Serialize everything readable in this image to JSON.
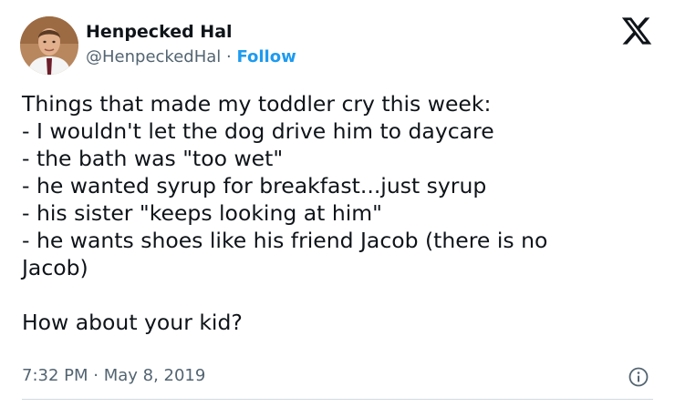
{
  "author": {
    "display_name": "Henpecked Hal",
    "handle": "@HenpeckedHal",
    "separator": " · ",
    "follow_label": "Follow"
  },
  "icons": {
    "brand": "x-logo-icon",
    "info": "info-icon",
    "avatar": "avatar-photo"
  },
  "tweet": {
    "lines": [
      "Things that made my toddler cry this week:",
      "- I wouldn't let the dog drive him to daycare",
      "- the bath was \"too wet\"",
      "- he wanted syrup for breakfast...just syrup",
      "- his sister \"keeps looking at him\"",
      "- he wants shoes like his friend Jacob (there is no",
      "Jacob)",
      "",
      "How about your kid?"
    ],
    "timestamp": "7:32 PM · May 8, 2019"
  },
  "colors": {
    "text": "#0f1419",
    "secondary": "#536471",
    "accent": "#1d9bf0",
    "divider": "#cfd9de"
  }
}
